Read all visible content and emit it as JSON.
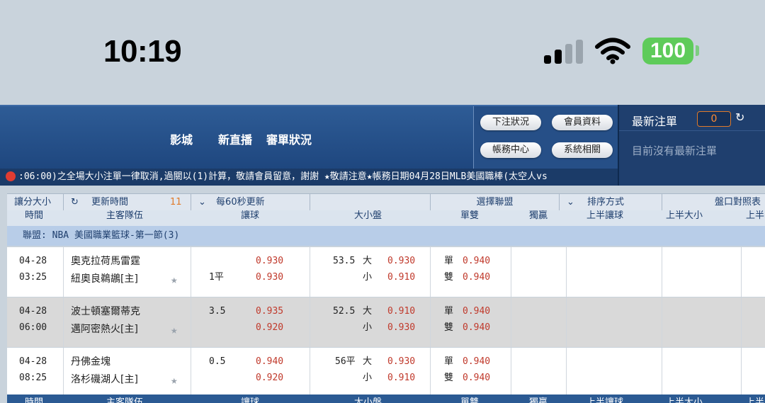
{
  "status_bar": {
    "time": "10:19",
    "battery": "100"
  },
  "header": {
    "nav_items": [
      "影城",
      "新直播",
      "審單狀況"
    ],
    "buttons": [
      "下注狀況",
      "會員資料",
      "帳務中心",
      "系統相關"
    ]
  },
  "latest_bets": {
    "title": "最新注單",
    "count": "0",
    "refresh_icon": "↻",
    "empty_message": "目前沒有最新注單"
  },
  "ticker": {
    "text": ":06:00)之全場大小注單一律取消,過關以(1)計算，敬請會員留意，謝謝  ★敬請注意★帳務日期04月28日MLB美國職棒(太空人vs"
  },
  "toolbar": {
    "ou_label": "讓分大小",
    "refresh_label": "更新時間",
    "refresh_count": "11",
    "auto_label": "每60秒更新",
    "league_label": "選擇聯盟",
    "sort_label": "排序方式",
    "compare_label": "盤口對照表"
  },
  "columns": [
    "時間",
    "主客隊伍",
    "讓球",
    "大小盤",
    "單雙",
    "獨贏",
    "上半讓球",
    "上半大小",
    "上半"
  ],
  "league": "聯盟: NBA 美國職業籃球-第一節(3)",
  "matches": [
    {
      "date": "04-28",
      "time": "03:25",
      "team1": "奧克拉荷馬雷霆",
      "team2": "紐奧良鵜鶘[主]",
      "hcp_line1": "",
      "hcp_line2": "1平",
      "hcp_odds1": "0.930",
      "hcp_odds2": "0.930",
      "ou_line": "53.5",
      "ou_over": "大",
      "ou_under": "小",
      "ou_odds1": "0.930",
      "ou_odds2": "0.910",
      "odd_label": "單",
      "even_label": "雙",
      "odd_odds": "0.940",
      "even_odds": "0.940"
    },
    {
      "date": "04-28",
      "time": "06:00",
      "team1": "波士頓塞爾蒂克",
      "team2": "邁阿密熱火[主]",
      "hcp_line1": "3.5",
      "hcp_line2": "",
      "hcp_odds1": "0.935",
      "hcp_odds2": "0.920",
      "ou_line": "52.5",
      "ou_over": "大",
      "ou_under": "小",
      "ou_odds1": "0.910",
      "ou_odds2": "0.930",
      "odd_label": "單",
      "even_label": "雙",
      "odd_odds": "0.940",
      "even_odds": "0.940"
    },
    {
      "date": "04-28",
      "time": "08:25",
      "team1": "丹佛金塊",
      "team2": "洛杉磯湖人[主]",
      "hcp_line1": "0.5",
      "hcp_line2": "",
      "hcp_odds1": "0.940",
      "hcp_odds2": "0.920",
      "ou_line": "56平",
      "ou_over": "大",
      "ou_under": "小",
      "ou_odds1": "0.930",
      "ou_odds2": "0.910",
      "odd_label": "單",
      "even_label": "雙",
      "odd_odds": "0.940",
      "even_odds": "0.940"
    }
  ],
  "colors": {
    "header": "#1e467e",
    "odds": "#c0392b",
    "battery": "#5ecb5a",
    "row_alt": "#d9d9d9"
  }
}
